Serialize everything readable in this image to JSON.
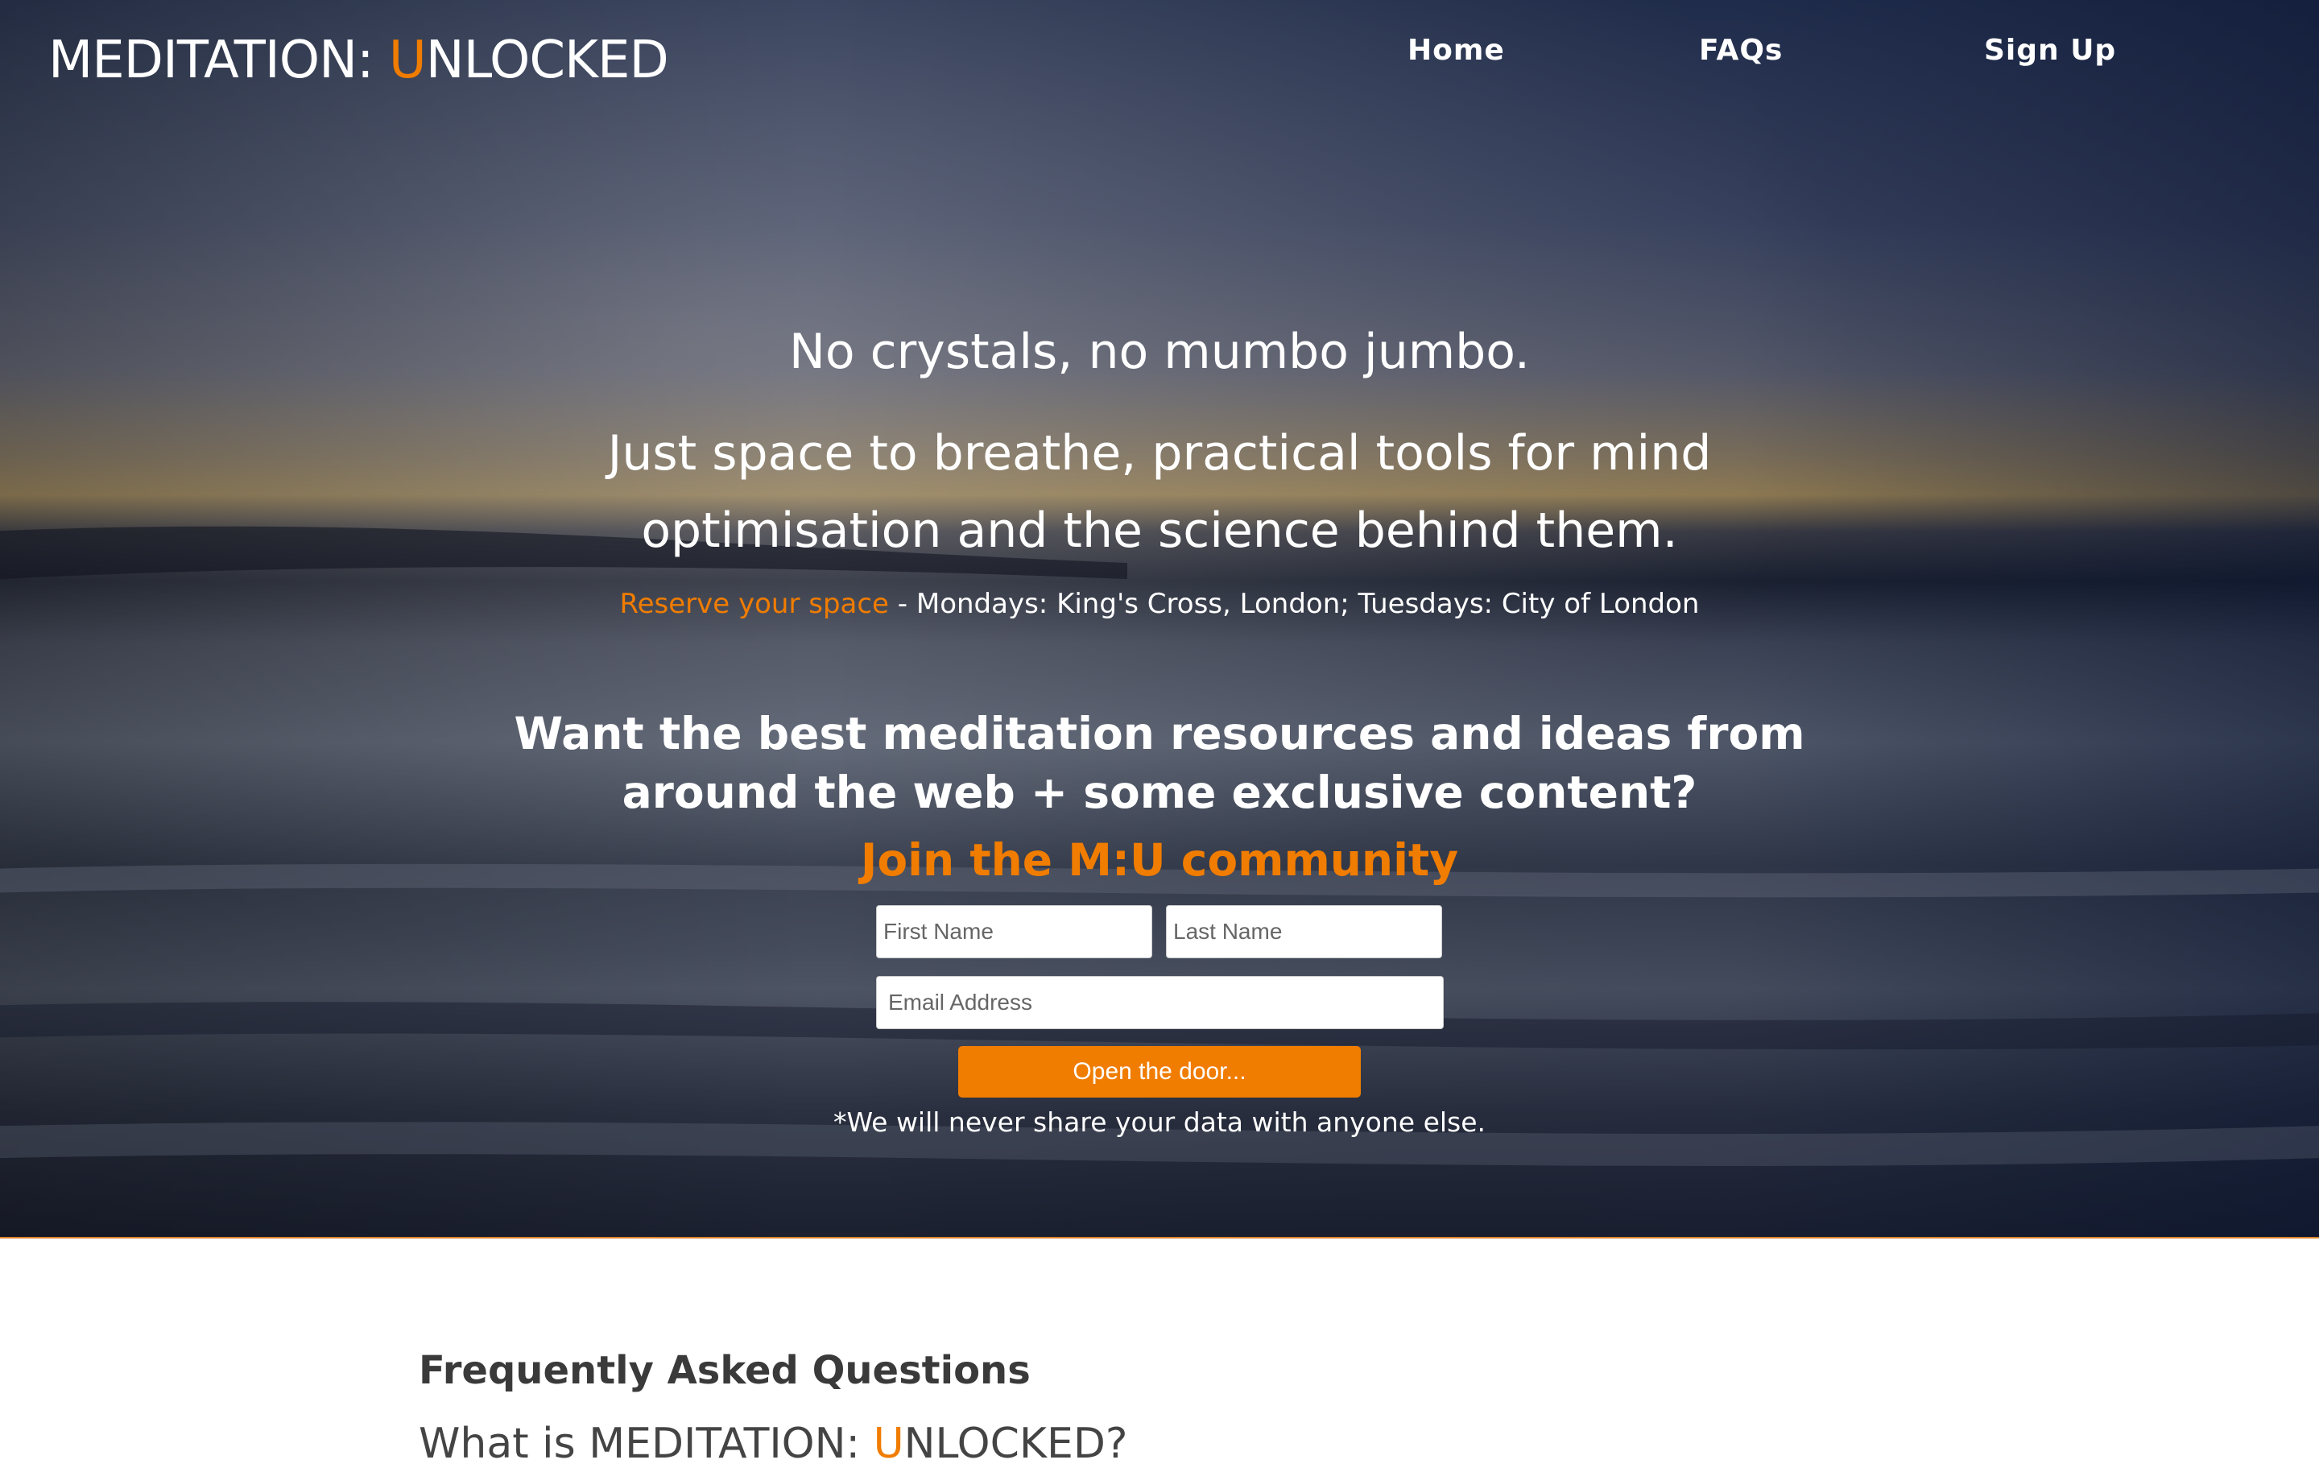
{
  "brand": {
    "logo_part1": "MEDITATION: ",
    "logo_accent": "U",
    "logo_part2": "NLOCKED"
  },
  "nav": {
    "home": "Home",
    "faqs": "FAQs",
    "signup": "Sign Up"
  },
  "hero": {
    "tagline_1": "No crystals, no mumbo jumbo.",
    "tagline_2": "Just space to breathe, practical tools for mind optimisation and the science behind them.",
    "reserve_link": "Reserve your space",
    "reserve_details": " - Mondays: King's Cross, London; Tuesdays: City of London",
    "want_heading": "Want the best meditation resources and ideas from around the web + some exclusive content?",
    "join_heading": "Join the M:U community"
  },
  "form": {
    "first_name_placeholder": "First Name",
    "last_name_placeholder": "Last Name",
    "email_placeholder": "Email Address",
    "submit_label": "Open the door...",
    "privacy_note": "*We will never share your data with anyone else."
  },
  "faq": {
    "title": "Frequently Asked Questions",
    "q1_part1": "What is MEDITATION: ",
    "q1_accent": "U",
    "q1_part2": "NLOCKED?"
  },
  "colors": {
    "accent": "#f07c00",
    "text_light": "#ffffff",
    "text_dark": "#3a3a3a"
  }
}
